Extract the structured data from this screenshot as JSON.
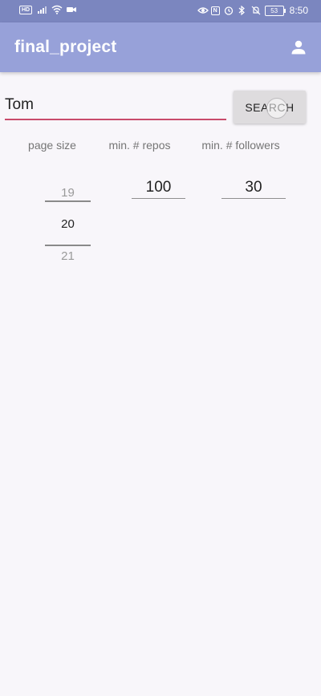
{
  "status_bar": {
    "left_icons": [
      "hd-icon",
      "signal-icon",
      "wifi-icon",
      "video-camera-icon"
    ],
    "hd_label": "HD",
    "right_icons": [
      "eye-icon",
      "nfc-icon",
      "alarm-icon",
      "bluetooth-icon",
      "mute-icon"
    ],
    "nfc_label": "N",
    "battery": "53",
    "time": "8:50"
  },
  "app_bar": {
    "title": "final_project",
    "account_icon": "account-icon",
    "background_color": "#97a1d9"
  },
  "search": {
    "value": "Tom",
    "button_label": "SEARCH",
    "underline_color": "#c94a6b"
  },
  "filters": {
    "labels": {
      "page_size": "page size",
      "min_repos": "min. # repos",
      "min_followers": "min. # followers"
    },
    "page_size": {
      "previous": "19",
      "current": "20",
      "next": "21"
    },
    "min_repos": "100",
    "min_followers": "30"
  }
}
